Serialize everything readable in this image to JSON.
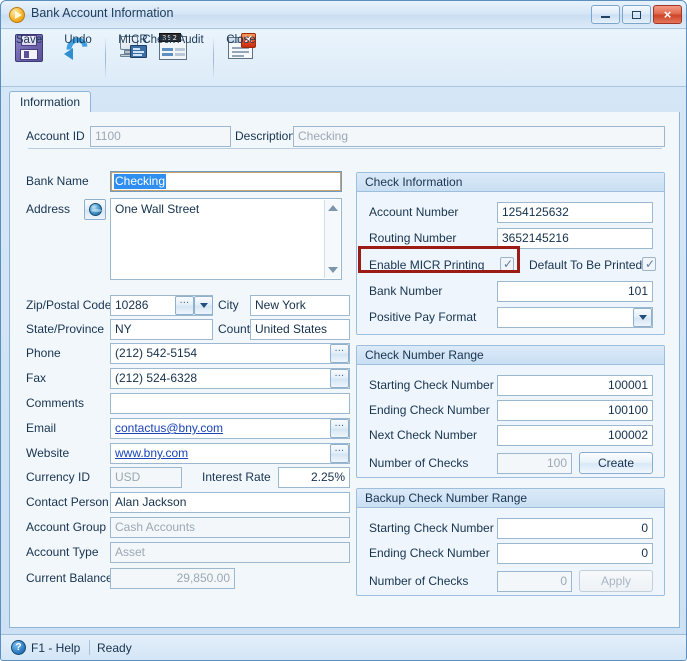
{
  "window": {
    "title": "Bank Account Information",
    "icon": "play-circle-icon",
    "controls": {
      "minimize": "–",
      "maximize": "□",
      "close": "×"
    }
  },
  "toolbar": {
    "buttons": [
      {
        "label": "Save",
        "icon": "floppy-disk-icon"
      },
      {
        "label": "Undo",
        "icon": "undo-arrow-icon"
      },
      {
        "label": "MICR",
        "icon": "monitor-icon"
      },
      {
        "label": "Check Audit",
        "icon": "check-counter-icon"
      },
      {
        "label": "Close",
        "icon": "window-close-icon"
      }
    ],
    "audit_counter": "392"
  },
  "tabs": [
    {
      "label": "Information",
      "active": true
    }
  ],
  "header": {
    "account_id_label": "Account ID",
    "account_id_value": "1100",
    "description_label": "Description",
    "description_value": "Checking"
  },
  "left_form": {
    "bank_name_label": "Bank Name",
    "bank_name_value": "Checking",
    "address_label": "Address",
    "address_value": "One Wall Street",
    "zip_label": "Zip/Postal Code",
    "zip_value": "10286",
    "city_label": "City",
    "city_value": "New York",
    "state_label": "State/Province",
    "state_value": "NY",
    "country_label": "Country",
    "country_value": "United States",
    "phone_label": "Phone",
    "phone_value": "(212) 542-5154",
    "fax_label": "Fax",
    "fax_value": "(212) 524-6328",
    "comments_label": "Comments",
    "comments_value": "",
    "email_label": "Email",
    "email_value": "contactus@bny.com",
    "website_label": "Website",
    "website_value": "www.bny.com",
    "currency_label": "Currency ID",
    "currency_value": "USD",
    "interest_rate_label": "Interest Rate",
    "interest_rate_value": "2.25%",
    "contact_person_label": "Contact Person",
    "contact_person_value": "Alan Jackson",
    "account_group_label": "Account Group",
    "account_group_value": "Cash Accounts",
    "account_type_label": "Account Type",
    "account_type_value": "Asset",
    "current_balance_label": "Current Balance",
    "current_balance_value": "29,850.00",
    "ellipsis": "∙∙∙"
  },
  "check_information": {
    "title": "Check Information",
    "account_number_label": "Account Number",
    "account_number_value": "1254125632",
    "routing_number_label": "Routing Number",
    "routing_number_value": "3652145216",
    "enable_micr_label": "Enable MICR Printing",
    "enable_micr_checked": true,
    "default_printed_label": "Default To Be Printed",
    "default_printed_checked": true,
    "bank_number_label": "Bank Number",
    "bank_number_value": "101",
    "positive_pay_label": "Positive Pay Format",
    "positive_pay_value": "",
    "highlight_color": "#9c1b15"
  },
  "check_number_range": {
    "title": "Check Number Range",
    "starting_label": "Starting Check Number",
    "starting_value": "100001",
    "ending_label": "Ending Check Number",
    "ending_value": "100100",
    "next_label": "Next Check Number",
    "next_value": "100002",
    "number_of_checks_label": "Number of Checks",
    "number_of_checks_value": "100",
    "create_button": "Create"
  },
  "backup_check_number_range": {
    "title": "Backup Check Number Range",
    "starting_label": "Starting Check Number",
    "starting_value": "0",
    "ending_label": "Ending Check Number",
    "ending_value": "0",
    "number_of_checks_label": "Number of Checks",
    "number_of_checks_value": "0",
    "apply_button": "Apply"
  },
  "statusbar": {
    "help_icon": "question-mark-icon",
    "help_text": "F1 - Help",
    "status_text": "Ready"
  },
  "checkmark": "✓"
}
